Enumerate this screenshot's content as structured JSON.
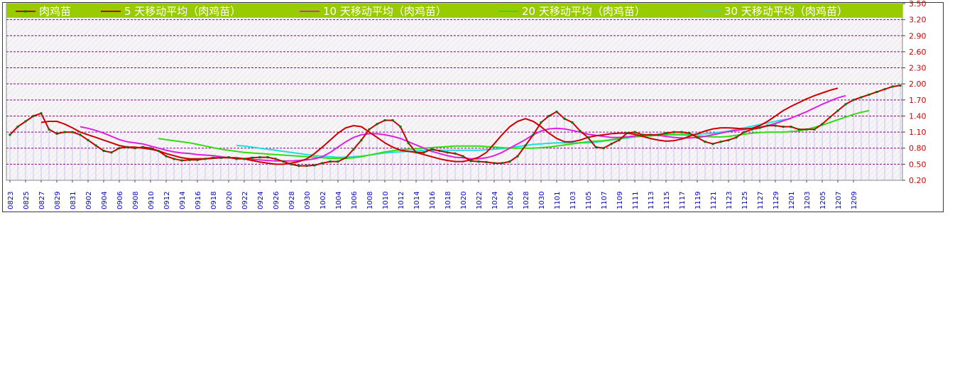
{
  "chart_data": {
    "type": "line",
    "title": "",
    "xlabel": "",
    "ylabel": "",
    "ylim": [
      0.2,
      3.5
    ],
    "grid": true,
    "legend_position": "top",
    "yticks": [
      "3.50",
      "3.20",
      "2.90",
      "2.60",
      "2.30",
      "2.00",
      "1.70",
      "1.40",
      "1.10",
      "0.80",
      "0.50",
      "0.20"
    ],
    "xticks": [
      "0823",
      "0825",
      "0827",
      "0829",
      "0831",
      "0902",
      "0904",
      "0906",
      "0908",
      "0910",
      "0912",
      "0914",
      "0916",
      "0918",
      "0920",
      "0922",
      "0924",
      "0926",
      "0928",
      "0930",
      "1002",
      "1004",
      "1006",
      "1008",
      "1010",
      "1012",
      "1014",
      "1016",
      "1018",
      "1020",
      "1022",
      "1024",
      "1026",
      "1028",
      "1030",
      "1101",
      "1103",
      "1105",
      "1107",
      "1109",
      "1111",
      "1113",
      "1115",
      "1117",
      "1119",
      "1121",
      "1123",
      "1125",
      "1127",
      "1129",
      "1201",
      "1203",
      "1205",
      "1207",
      "1209"
    ],
    "colors": {
      "price": "#cc0000",
      "price_marker": "#007700",
      "ma5": "#cc0000",
      "ma10": "#dd22dd",
      "ma20": "#33dd11",
      "ma30": "#22dddd",
      "legend_bg": "#99cc00",
      "grid": "#880088",
      "bars": "#c8c8f4"
    },
    "series": [
      {
        "name": "肉鸡苗",
        "key": "price",
        "start": 0,
        "values": [
          1.05,
          1.2,
          1.3,
          1.4,
          1.45,
          1.15,
          1.07,
          1.1,
          1.1,
          1.05,
          0.95,
          0.85,
          0.75,
          0.72,
          0.8,
          0.82,
          0.8,
          0.82,
          0.8,
          0.75,
          0.65,
          0.6,
          0.57,
          0.58,
          0.58,
          0.6,
          0.62,
          0.62,
          0.63,
          0.6,
          0.6,
          0.62,
          0.63,
          0.63,
          0.6,
          0.55,
          0.5,
          0.47,
          0.47,
          0.48,
          0.52,
          0.55,
          0.55,
          0.62,
          0.78,
          0.95,
          1.15,
          1.25,
          1.32,
          1.32,
          1.2,
          0.9,
          0.72,
          0.72,
          0.78,
          0.75,
          0.72,
          0.7,
          0.65,
          0.56,
          0.55,
          0.54,
          0.52,
          0.52,
          0.55,
          0.65,
          0.85,
          1.05,
          1.28,
          1.4,
          1.48,
          1.35,
          1.28,
          1.12,
          1.0,
          0.82,
          0.8,
          0.88,
          0.95,
          1.08,
          1.1,
          1.05,
          1.05,
          1.05,
          1.08,
          1.1,
          1.1,
          1.08,
          1.0,
          0.92,
          0.88,
          0.92,
          0.95,
          1.0,
          1.1,
          1.15,
          1.18,
          1.22,
          1.22,
          1.2,
          1.2,
          1.15,
          1.15,
          1.15,
          1.25,
          1.38,
          1.5,
          1.62,
          1.7,
          1.75,
          1.8,
          1.85,
          1.9,
          1.95,
          1.97
        ]
      },
      {
        "name": "5 天移动平均（肉鸡苗）",
        "key": "ma5",
        "start": 4,
        "values": [
          1.28,
          1.3,
          1.3,
          1.25,
          1.18,
          1.1,
          1.05,
          1.0,
          0.95,
          0.9,
          0.85,
          0.82,
          0.82,
          0.8,
          0.78,
          0.75,
          0.7,
          0.66,
          0.62,
          0.6,
          0.6,
          0.6,
          0.61,
          0.62,
          0.62,
          0.62,
          0.6,
          0.57,
          0.54,
          0.52,
          0.5,
          0.5,
          0.52,
          0.55,
          0.6,
          0.7,
          0.82,
          0.95,
          1.08,
          1.18,
          1.22,
          1.2,
          1.1,
          1.0,
          0.9,
          0.82,
          0.76,
          0.74,
          0.72,
          0.68,
          0.64,
          0.6,
          0.57,
          0.55,
          0.55,
          0.58,
          0.63,
          0.72,
          0.88,
          1.05,
          1.2,
          1.3,
          1.35,
          1.3,
          1.2,
          1.08,
          0.98,
          0.92,
          0.92,
          0.95,
          1.0,
          1.03,
          1.05,
          1.07,
          1.08,
          1.08,
          1.06,
          1.02,
          0.98,
          0.95,
          0.93,
          0.94,
          0.97,
          1.02,
          1.07,
          1.12,
          1.16,
          1.18,
          1.18,
          1.17,
          1.16,
          1.17,
          1.22,
          1.3,
          1.4,
          1.5,
          1.58,
          1.65,
          1.72,
          1.78,
          1.83,
          1.88,
          1.92
        ]
      },
      {
        "name": "10 天移动平均（肉鸡苗）",
        "key": "ma10",
        "start": 9,
        "values": [
          1.2,
          1.17,
          1.13,
          1.08,
          1.02,
          0.96,
          0.92,
          0.9,
          0.88,
          0.84,
          0.8,
          0.76,
          0.73,
          0.71,
          0.7,
          0.68,
          0.67,
          0.66,
          0.64,
          0.62,
          0.61,
          0.6,
          0.59,
          0.58,
          0.57,
          0.56,
          0.56,
          0.56,
          0.57,
          0.58,
          0.6,
          0.64,
          0.72,
          0.82,
          0.92,
          1.0,
          1.05,
          1.07,
          1.07,
          1.05,
          1.02,
          0.98,
          0.92,
          0.86,
          0.8,
          0.74,
          0.7,
          0.66,
          0.63,
          0.62,
          0.6,
          0.6,
          0.62,
          0.66,
          0.72,
          0.8,
          0.88,
          0.96,
          1.05,
          1.12,
          1.16,
          1.17,
          1.16,
          1.13,
          1.1,
          1.06,
          1.04,
          1.02,
          1.0,
          1.0,
          1.01,
          1.03,
          1.04,
          1.05,
          1.04,
          1.02,
          1.0,
          0.99,
          0.99,
          1.0,
          1.02,
          1.05,
          1.08,
          1.11,
          1.13,
          1.15,
          1.17,
          1.19,
          1.22,
          1.26,
          1.31,
          1.36,
          1.42,
          1.48,
          1.55,
          1.62,
          1.68,
          1.74,
          1.78
        ]
      },
      {
        "name": "20 天移动平均（肉鸡苗）",
        "key": "ma20",
        "start": 19,
        "values": [
          0.98,
          0.96,
          0.94,
          0.92,
          0.9,
          0.87,
          0.84,
          0.81,
          0.78,
          0.76,
          0.74,
          0.72,
          0.71,
          0.7,
          0.69,
          0.68,
          0.67,
          0.66,
          0.65,
          0.64,
          0.63,
          0.62,
          0.61,
          0.61,
          0.61,
          0.62,
          0.64,
          0.67,
          0.7,
          0.73,
          0.75,
          0.77,
          0.78,
          0.79,
          0.8,
          0.81,
          0.82,
          0.83,
          0.84,
          0.84,
          0.84,
          0.84,
          0.83,
          0.82,
          0.81,
          0.8,
          0.8,
          0.8,
          0.8,
          0.81,
          0.82,
          0.84,
          0.86,
          0.88,
          0.9,
          0.92,
          0.93,
          0.94,
          0.96,
          0.98,
          1.0,
          1.01,
          1.02,
          1.03,
          1.04,
          1.05,
          1.05,
          1.05,
          1.04,
          1.03,
          1.02,
          1.01,
          1.01,
          1.02,
          1.04,
          1.06,
          1.08,
          1.09,
          1.1,
          1.1,
          1.1,
          1.11,
          1.12,
          1.15,
          1.19,
          1.23,
          1.28,
          1.33,
          1.38,
          1.43,
          1.47,
          1.5
        ]
      },
      {
        "name": "30 天移动平均（肉鸡苗）",
        "key": "ma30",
        "start": 29,
        "values": [
          0.85,
          0.84,
          0.82,
          0.8,
          0.78,
          0.76,
          0.74,
          0.72,
          0.7,
          0.68,
          0.66,
          0.65,
          0.64,
          0.63,
          0.63,
          0.64,
          0.65,
          0.67,
          0.69,
          0.71,
          0.72,
          0.73,
          0.74,
          0.75,
          0.76,
          0.76,
          0.76,
          0.76,
          0.76,
          0.76,
          0.76,
          0.76,
          0.77,
          0.78,
          0.79,
          0.81,
          0.83,
          0.85,
          0.87,
          0.88,
          0.89,
          0.9,
          0.9,
          0.9,
          0.9,
          0.9,
          0.91,
          0.93,
          0.95,
          0.97,
          0.99,
          1.01,
          1.03,
          1.04,
          1.05,
          1.06,
          1.06,
          1.06,
          1.06,
          1.06,
          1.07,
          1.08,
          1.1,
          1.12,
          1.15,
          1.18,
          1.21,
          1.24,
          1.27,
          1.3,
          1.33,
          1.35
        ]
      }
    ]
  }
}
